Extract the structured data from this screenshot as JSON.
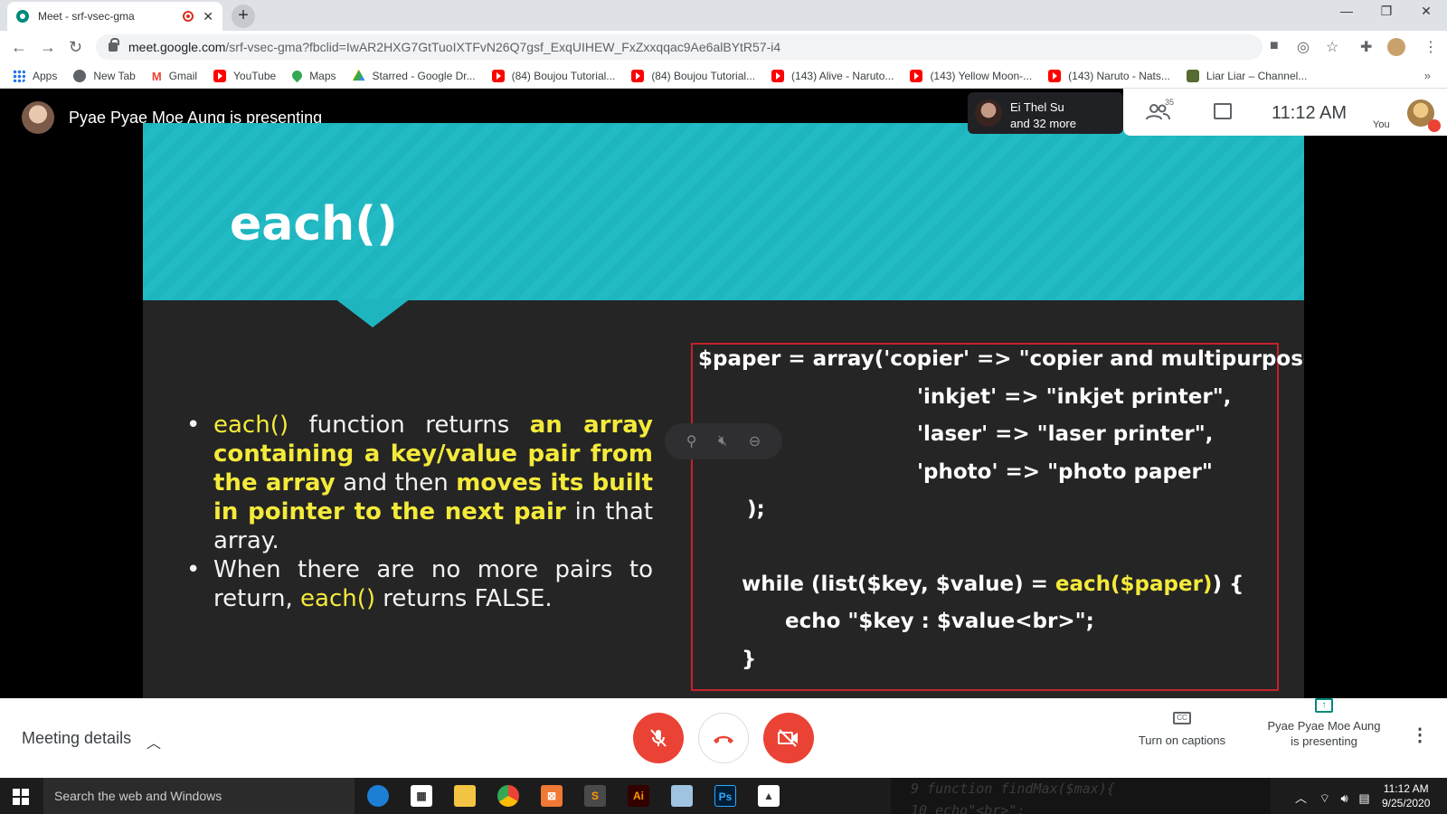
{
  "browser": {
    "tab_title": "Meet - srf-vsec-gma",
    "new_tab_glyph": "+",
    "window_controls": [
      "—",
      "❐",
      "✕"
    ],
    "url_host": "meet.google.com",
    "url_path": "/srf-vsec-gma?fbclid=IwAR2HXG7GtTuoIXTFvN26Q7gsf_ExqUIHEW_FxZxxqqac9Ae6alBYtR57-i4",
    "bookmarks": [
      {
        "label": "Apps",
        "icon": "apps-icon"
      },
      {
        "label": "New Tab",
        "icon": "globe-icon"
      },
      {
        "label": "Gmail",
        "icon": "gmail-icon"
      },
      {
        "label": "YouTube",
        "icon": "youtube-icon"
      },
      {
        "label": "Maps",
        "icon": "maps-icon"
      },
      {
        "label": "Starred - Google Dr...",
        "icon": "drive-icon"
      },
      {
        "label": "(84) Boujou Tutorial...",
        "icon": "youtube-icon"
      },
      {
        "label": "(84) Boujou Tutorial...",
        "icon": "youtube-icon"
      },
      {
        "label": "(143) Alive - Naruto...",
        "icon": "youtube-icon"
      },
      {
        "label": "(143) Yellow Moon-...",
        "icon": "youtube-icon"
      },
      {
        "label": "(143) Naruto - Nats...",
        "icon": "youtube-icon"
      },
      {
        "label": "Liar Liar – Channel...",
        "icon": "channel-icon"
      }
    ],
    "bookmarks_more": "»"
  },
  "meet": {
    "presenter_label": "Pyae Pyae Moe Aung is presenting",
    "participant_name": "Ei Thel Su",
    "participant_more": "and 32 more",
    "people_count": "35",
    "clock": "11:12 AM",
    "you_label": "You",
    "meeting_details": "Meeting details",
    "captions_label": "Turn on captions",
    "presenting_line1": "Pyae Pyae Moe Aung",
    "presenting_line2": "is presenting"
  },
  "slide": {
    "title": "each()",
    "bullet1": {
      "p1": "each()",
      "p2": " function returns ",
      "p3": "an array containing a key/value pair from the array",
      "p4": " and then ",
      "p5": "moves its built in pointer to the next pair",
      "p6": " in that array."
    },
    "bullet2": {
      "p1": "When there are no more pairs to return, ",
      "p2": "each()",
      "p3": " returns FALSE."
    },
    "code": {
      "l1": "$paper = array('copier' => \"copier and multipurpose\",",
      "l2": "'inkjet' => \"inkjet printer\",",
      "l3": "'laser' => \"laser printer\",",
      "l4": "'photo' => \"photo paper\"",
      "l5": ");",
      "l6a": "while (list($key, $value) = ",
      "l6b": "each($paper)",
      "l6c": ") {",
      "l7": "echo \"$key : $value<br>\";",
      "l8": "}"
    }
  },
  "taskbar": {
    "search_placeholder": "Search the web and Windows",
    "code_line1": "9   function findMax($max){",
    "code_line2": "10        echo\"<br>\";",
    "time": "11:12 AM",
    "date": "9/25/2020"
  },
  "colors": {
    "slide_header": "#1fb5bf",
    "highlight": "#f4ea3a",
    "code_border": "#c4222a",
    "end_call_red": "#ea4335"
  }
}
